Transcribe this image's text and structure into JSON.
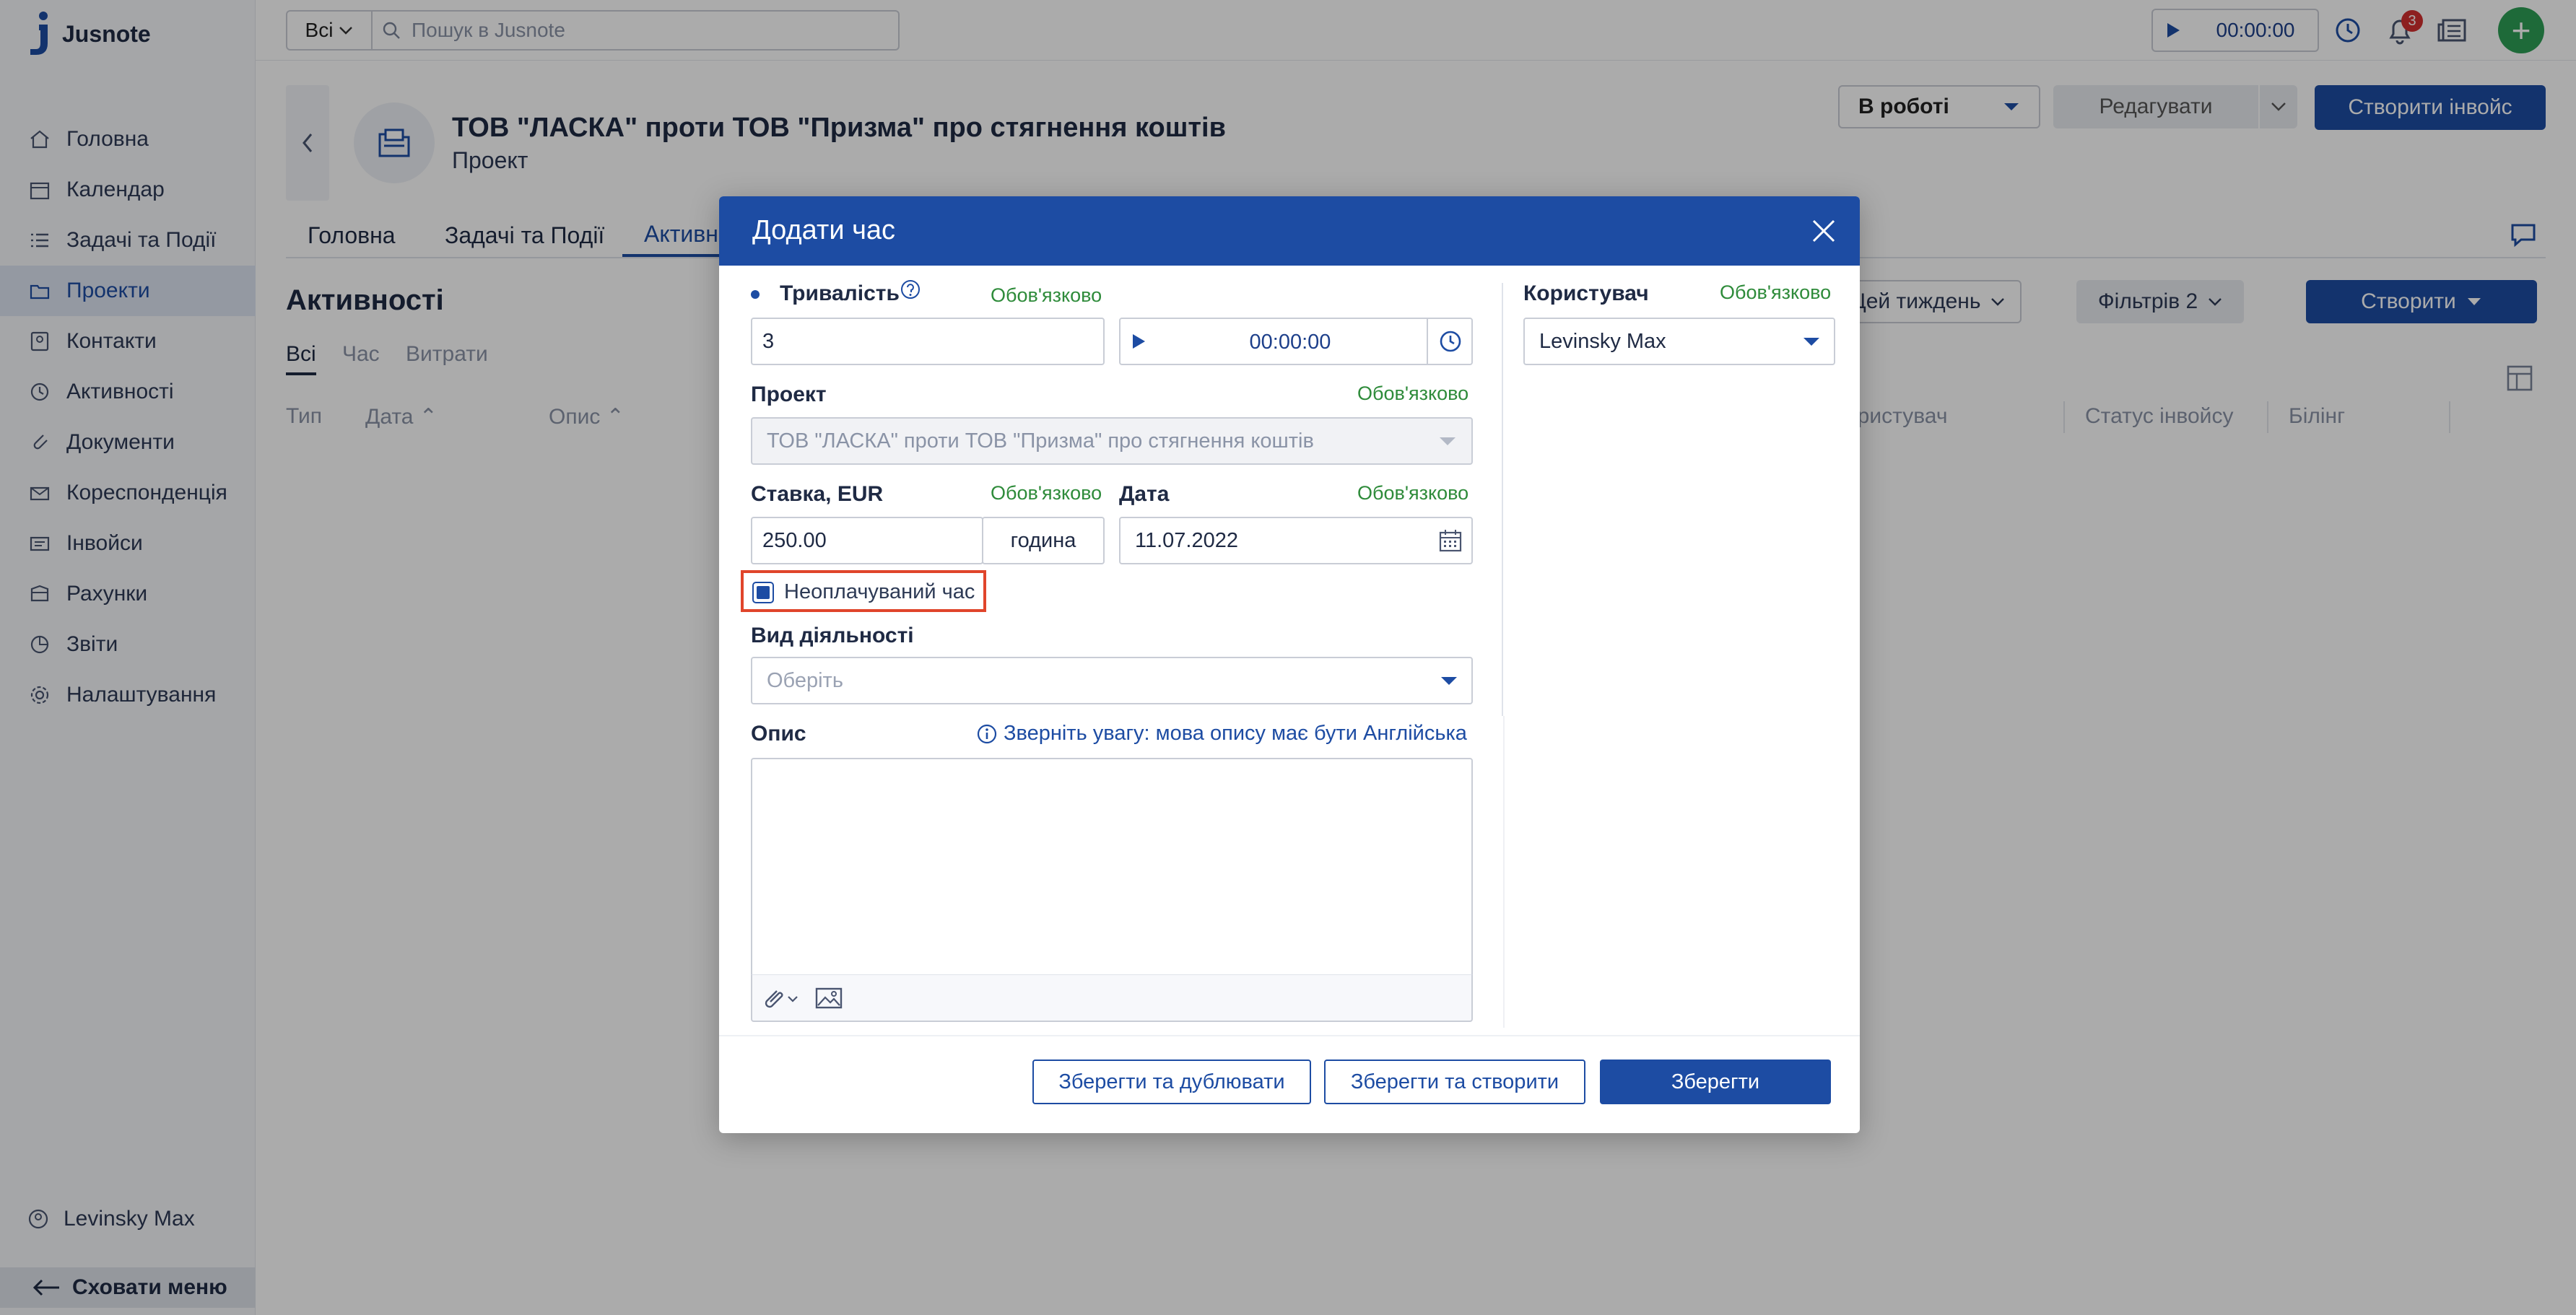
{
  "app": {
    "name": "Jusnote"
  },
  "sidebar": {
    "items": [
      {
        "label": "Головна",
        "icon": "home-icon"
      },
      {
        "label": "Календар",
        "icon": "calendar-icon"
      },
      {
        "label": "Задачі та Події",
        "icon": "tasks-icon"
      },
      {
        "label": "Проекти",
        "icon": "projects-icon",
        "active": true
      },
      {
        "label": "Контакти",
        "icon": "contacts-icon"
      },
      {
        "label": "Активності",
        "icon": "activities-icon"
      },
      {
        "label": "Документи",
        "icon": "documents-icon"
      },
      {
        "label": "Кореспонденція",
        "icon": "correspondence-icon"
      },
      {
        "label": "Інвойси",
        "icon": "invoices-icon"
      },
      {
        "label": "Рахунки",
        "icon": "accounts-icon"
      },
      {
        "label": "Звіти",
        "icon": "reports-icon"
      },
      {
        "label": "Налаштування",
        "icon": "settings-icon"
      }
    ],
    "user": "Levinsky Max",
    "hide_menu": "Сховати меню"
  },
  "topbar": {
    "scope": "Всі",
    "search_placeholder": "Пошук в Jusnote",
    "timer": "00:00:00",
    "notifications_count": "3",
    "add_label": "+"
  },
  "project": {
    "title": "ТОВ \"ЛАСКА\" проти ТОВ \"Призма\" про стягнення коштів",
    "subtitle": "Проект",
    "status": "В роботі",
    "edit_label": "Редагувати",
    "invoice_label": "Створити інвойс",
    "tabs": [
      "Головна",
      "Задачі та Події",
      "Активн"
    ]
  },
  "activities": {
    "title": "Активності",
    "subtabs": [
      "Всі",
      "Час",
      "Витрати"
    ],
    "columns": [
      "Тип",
      "Дата",
      "Опис",
      "ористувач",
      "Статус інвойсу",
      "Білінг"
    ],
    "period_filter": "Цей тиждень",
    "filters": "Фільтрів 2",
    "create": "Створити"
  },
  "dialog": {
    "title": "Додати час",
    "duration_label": "Тривалість",
    "required": "Обов'язково",
    "duration_value": "3",
    "timer_value": "00:00:00",
    "project_label": "Проект",
    "project_value": "ТОВ \"ЛАСКА\" проти ТОВ \"Призма\" про стягнення коштів",
    "rate_label": "Ставка, EUR",
    "rate_value": "250.00",
    "rate_unit": "година",
    "date_label": "Дата",
    "date_value": "11.07.2022",
    "nonbillable_label": "Неоплачуваний час",
    "activity_type_label": "Вид діяльності",
    "activity_type_placeholder": "Оберіть",
    "description_label": "Опис",
    "description_note": "Зверніть увагу: мова опису має бути Англійська",
    "user_label": "Користувач",
    "user_value": "Levinsky Max",
    "btn_save_duplicate": "Зберегти та дублювати",
    "btn_save_create": "Зберегти та створити",
    "btn_save": "Зберегти"
  },
  "colors": {
    "primary": "#1d4ca3",
    "required": "#2e8b3a",
    "highlight": "#e0452b",
    "add": "#2e9e55"
  }
}
